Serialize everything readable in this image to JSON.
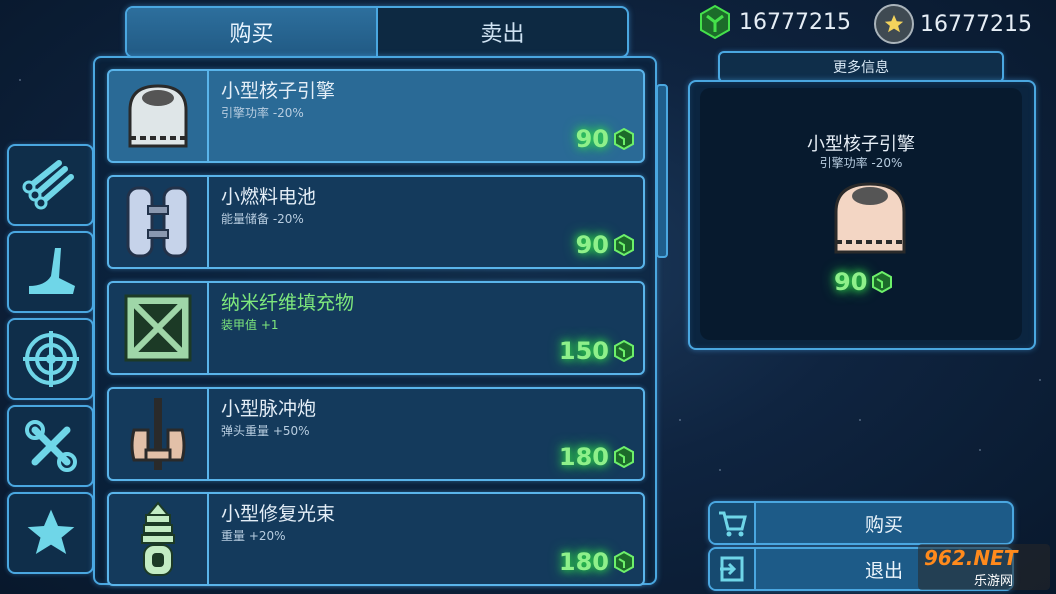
{
  "tabs": {
    "buy": "购买",
    "sell": "卖出"
  },
  "currency": {
    "green_amount": "16777215",
    "star_amount": "16777215"
  },
  "side_tabs": [
    {
      "icon": "pipes-icon"
    },
    {
      "icon": "boot-icon"
    },
    {
      "icon": "target-icon"
    },
    {
      "icon": "tools-icon"
    },
    {
      "icon": "star-icon"
    }
  ],
  "items": [
    {
      "name": "小型核子引擎",
      "desc": "引擎功率 -20%",
      "price": "90",
      "icon": "engine-icon"
    },
    {
      "name": "小燃料电池",
      "desc": "能量储备 -20%",
      "price": "90",
      "icon": "fuel-cell-icon"
    },
    {
      "name": "纳米纤维填充物",
      "desc": "装甲值 +1",
      "price": "150",
      "icon": "nanofiber-icon"
    },
    {
      "name": "小型脉冲炮",
      "desc": "弹头重量 +50%",
      "price": "180",
      "icon": "pulse-cannon-icon"
    },
    {
      "name": "小型修复光束",
      "desc": "重量 +20%",
      "price": "180",
      "icon": "repair-beam-icon"
    }
  ],
  "detail": {
    "more_info": "更多信息",
    "name": "小型核子引擎",
    "desc": "引擎功率 -20%",
    "price": "90"
  },
  "actions": {
    "buy": "购买",
    "exit": "退出"
  },
  "watermark": {
    "top": "962.NET",
    "bottom": "乐游网"
  },
  "colors": {
    "accent": "#4aa7e0",
    "price_green": "#8ef08a",
    "panel": "#143a5c"
  }
}
